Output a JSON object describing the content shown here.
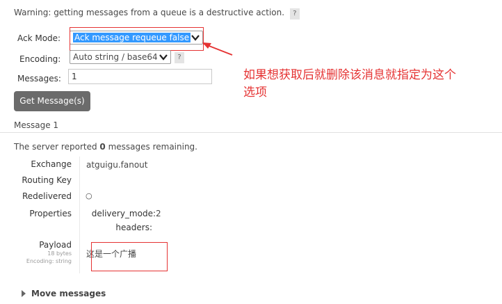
{
  "warning": {
    "text": "Warning: getting messages from a queue is a destructive action.",
    "help": "?"
  },
  "form": {
    "ack_mode_label": "Ack Mode:",
    "ack_mode_value": "Ack message requeue false",
    "encoding_label": "Encoding:",
    "encoding_value": "Auto string / base64",
    "encoding_help": "?",
    "messages_label": "Messages:",
    "messages_value": "1",
    "get_button": "Get Message(s)"
  },
  "annotation": {
    "line1": "如果想获取后就删除该消息就指定为这个",
    "line2": "选项",
    "color": "#e53333"
  },
  "message": {
    "section_title": "Message 1",
    "remaining_prefix": "The server reported ",
    "remaining_count": "0",
    "remaining_suffix": " messages remaining.",
    "exchange_label": "Exchange",
    "exchange_value": "atguigu.fanout",
    "routing_key_label": "Routing Key",
    "routing_key_value": "",
    "redelivered_label": "Redelivered",
    "redelivered_value": "○",
    "properties_label": "Properties",
    "delivery_mode_label": "delivery_mode:",
    "delivery_mode_value": "2",
    "headers_label": "headers:",
    "payload_label": "Payload",
    "payload_bytes": "18 bytes",
    "payload_encoding": "Encoding: string",
    "payload_value": "这是一个广播"
  },
  "move": {
    "label": "Move messages"
  }
}
